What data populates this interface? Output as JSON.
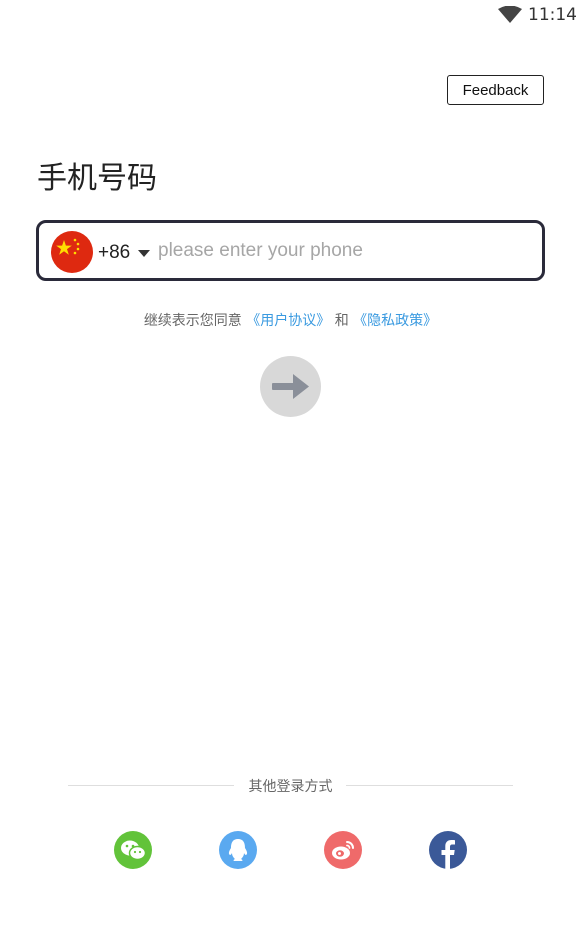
{
  "status_bar": {
    "time": "11:14",
    "wifi_icon": "wifi-icon"
  },
  "header": {
    "feedback_label": "Feedback"
  },
  "page": {
    "title": "手机号码"
  },
  "phone": {
    "country_flag_icon": "china-flag-icon",
    "country_code": "+86",
    "value": "",
    "placeholder": "please enter your phone"
  },
  "agreement": {
    "prefix": "继续表示您同意",
    "user_agreement": "《用户协议》",
    "conjunction": "和",
    "privacy_policy": "《隐私政策》"
  },
  "next_button": {
    "icon": "arrow-right-icon"
  },
  "other_login": {
    "label": "其他登录方式",
    "methods": [
      {
        "icon": "wechat-icon",
        "color": "#62c33a"
      },
      {
        "icon": "qq-icon",
        "color": "#5aa9f0"
      },
      {
        "icon": "weibo-icon",
        "color": "#ef6a6a"
      },
      {
        "icon": "facebook-icon",
        "color": "#3b5998"
      }
    ]
  }
}
